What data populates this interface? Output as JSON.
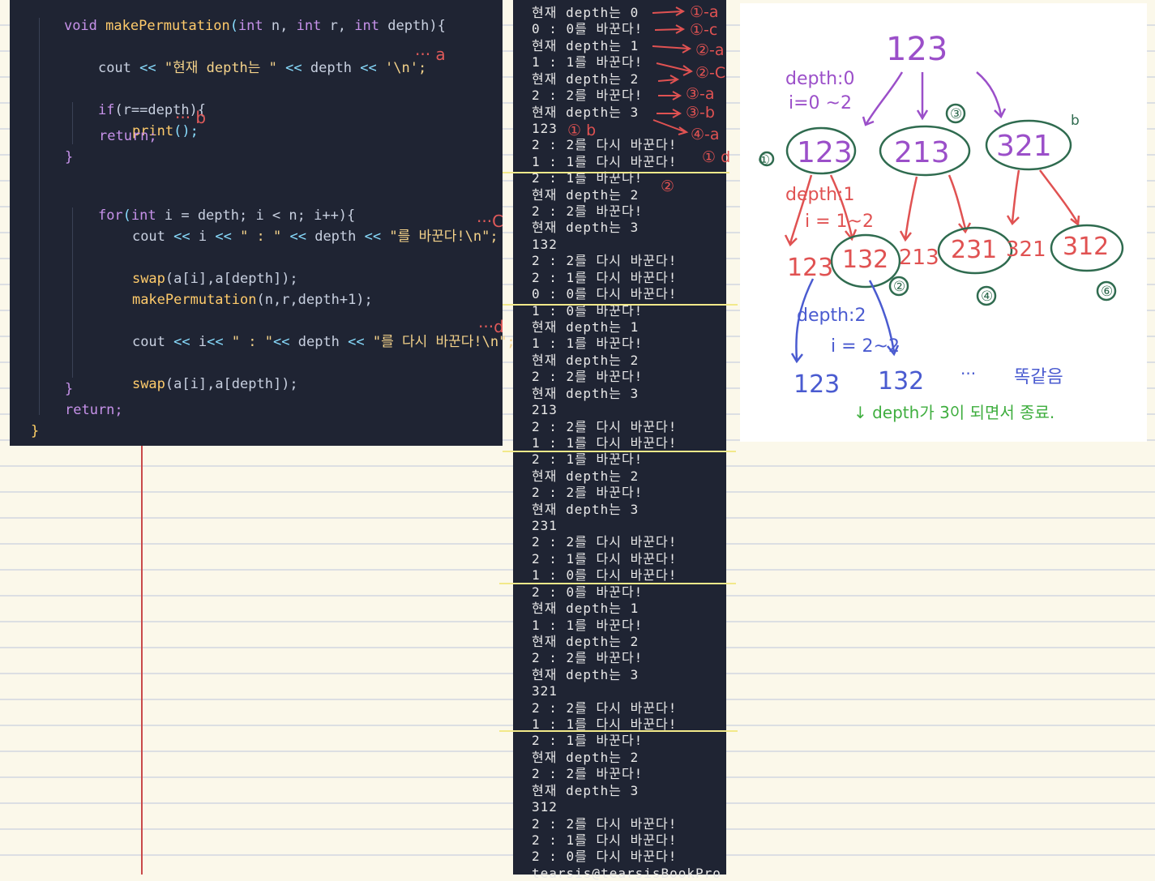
{
  "code": {
    "signature": [
      "void",
      "makePermutation",
      "(",
      "int",
      " n, ",
      "int",
      " r, ",
      "int",
      " depth){"
    ],
    "line_cout1": [
      "cout ",
      "<<",
      " \"현재 depth는 \" ",
      "<<",
      " depth ",
      "<<",
      " '\\n';"
    ],
    "line_if": [
      "if",
      "(r==depth){"
    ],
    "line_print": [
      "print",
      "();"
    ],
    "line_return1": "return;",
    "close_brace_1": "}",
    "line_for": [
      "for",
      "(",
      "int",
      " i = depth; i < n; i++){"
    ],
    "line_cout2": [
      "cout ",
      "<<",
      " i ",
      "<<",
      " \" : \" ",
      "<<",
      " depth ",
      "<<",
      " \"를 바꾼다!\\n\";"
    ],
    "line_swap1": [
      "swap",
      "(a[i],a[depth]);"
    ],
    "line_recurse": [
      "makePermutation",
      "(n,r,depth+1);"
    ],
    "line_cout3": [
      "cout ",
      "<<",
      " i",
      "<<",
      " \" : \"",
      "<<",
      " depth ",
      "<<",
      " \"를 다시 바꾼다!\\n\";"
    ],
    "line_swap2": [
      "swap",
      "(a[i],a[depth]);"
    ],
    "close_brace_2": "}",
    "line_return2": "return;",
    "close_brace_3": "}"
  },
  "code_annotations": {
    "a": "··· a",
    "b": "··· b",
    "c": "···C",
    "d": "···d"
  },
  "terminal": {
    "lines": [
      "현재 depth는 0",
      "0 : 0를 바꾼다!",
      "현재 depth는 1",
      "1 : 1를 바꾼다!",
      "현재 depth는 2",
      "2 : 2를 바꾼다!",
      "현재 depth는 3",
      "123",
      "2 : 2를 다시 바꾼다!",
      "1 : 1를 다시 바꾼다!",
      "2 : 1를 바꾼다!",
      "현재 depth는 2",
      "2 : 2를 바꾼다!",
      "현재 depth는 3",
      "132",
      "2 : 2를 다시 바꾼다!",
      "2 : 1를 다시 바꾼다!",
      "0 : 0를 다시 바꾼다!",
      "1 : 0를 바꾼다!",
      "현재 depth는 1",
      "1 : 1를 바꾼다!",
      "현재 depth는 2",
      "2 : 2를 바꾼다!",
      "현재 depth는 3",
      "213",
      "2 : 2를 다시 바꾼다!",
      "1 : 1를 다시 바꾼다!",
      "2 : 1를 바꾼다!",
      "현재 depth는 2",
      "2 : 2를 바꾼다!",
      "현재 depth는 3",
      "231",
      "2 : 2를 다시 바꾼다!",
      "2 : 1를 다시 바꾼다!",
      "1 : 0를 다시 바꾼다!",
      "2 : 0를 바꾼다!",
      "현재 depth는 1",
      "1 : 1를 바꾼다!",
      "현재 depth는 2",
      "2 : 2를 바꾼다!",
      "현재 depth는 3",
      "321",
      "2 : 2를 다시 바꾼다!",
      "1 : 1를 다시 바꾼다!",
      "2 : 1를 바꾼다!",
      "현재 depth는 2",
      "2 : 2를 바꾼다!",
      "현재 depth는 3",
      "312",
      "2 : 2를 다시 바꾼다!",
      "2 : 1를 다시 바꾼다!",
      "2 : 0를 다시 바꾼다!",
      "tearsis@tearsisBookPro"
    ]
  },
  "terminal_annotations": {
    "marks": [
      "①-a",
      "①-c",
      "②-a",
      "②-C",
      "③-a",
      "③-b",
      "④-a"
    ],
    "line123_mark": "① b",
    "line123_second": "① d",
    "line_132_mark": "②"
  },
  "notes": {
    "root": "123",
    "depth0": [
      "depth:0",
      "i=0 ~2"
    ],
    "level1": [
      "123",
      "213",
      "321"
    ],
    "level1_marks": [
      "①",
      "③",
      "b"
    ],
    "depth1": [
      "depth:1",
      "i = 1~2"
    ],
    "level2_plain": [
      "123",
      "213",
      "321"
    ],
    "level2_circled": [
      "132",
      "231",
      "312"
    ],
    "level2_marks": [
      "②",
      "④",
      "⑥"
    ],
    "depth2": [
      "depth:2",
      "i = 2~2"
    ],
    "level3": [
      "123",
      "132",
      "···",
      "똑같음"
    ],
    "footer": "↓ depth가 3이 되면서 종료.",
    "colors": {
      "purple": "#9b4fc9",
      "red": "#e05252",
      "green": "#2f6b4f",
      "blue": "#4a5bd0",
      "lime": "#3fae3f"
    }
  }
}
